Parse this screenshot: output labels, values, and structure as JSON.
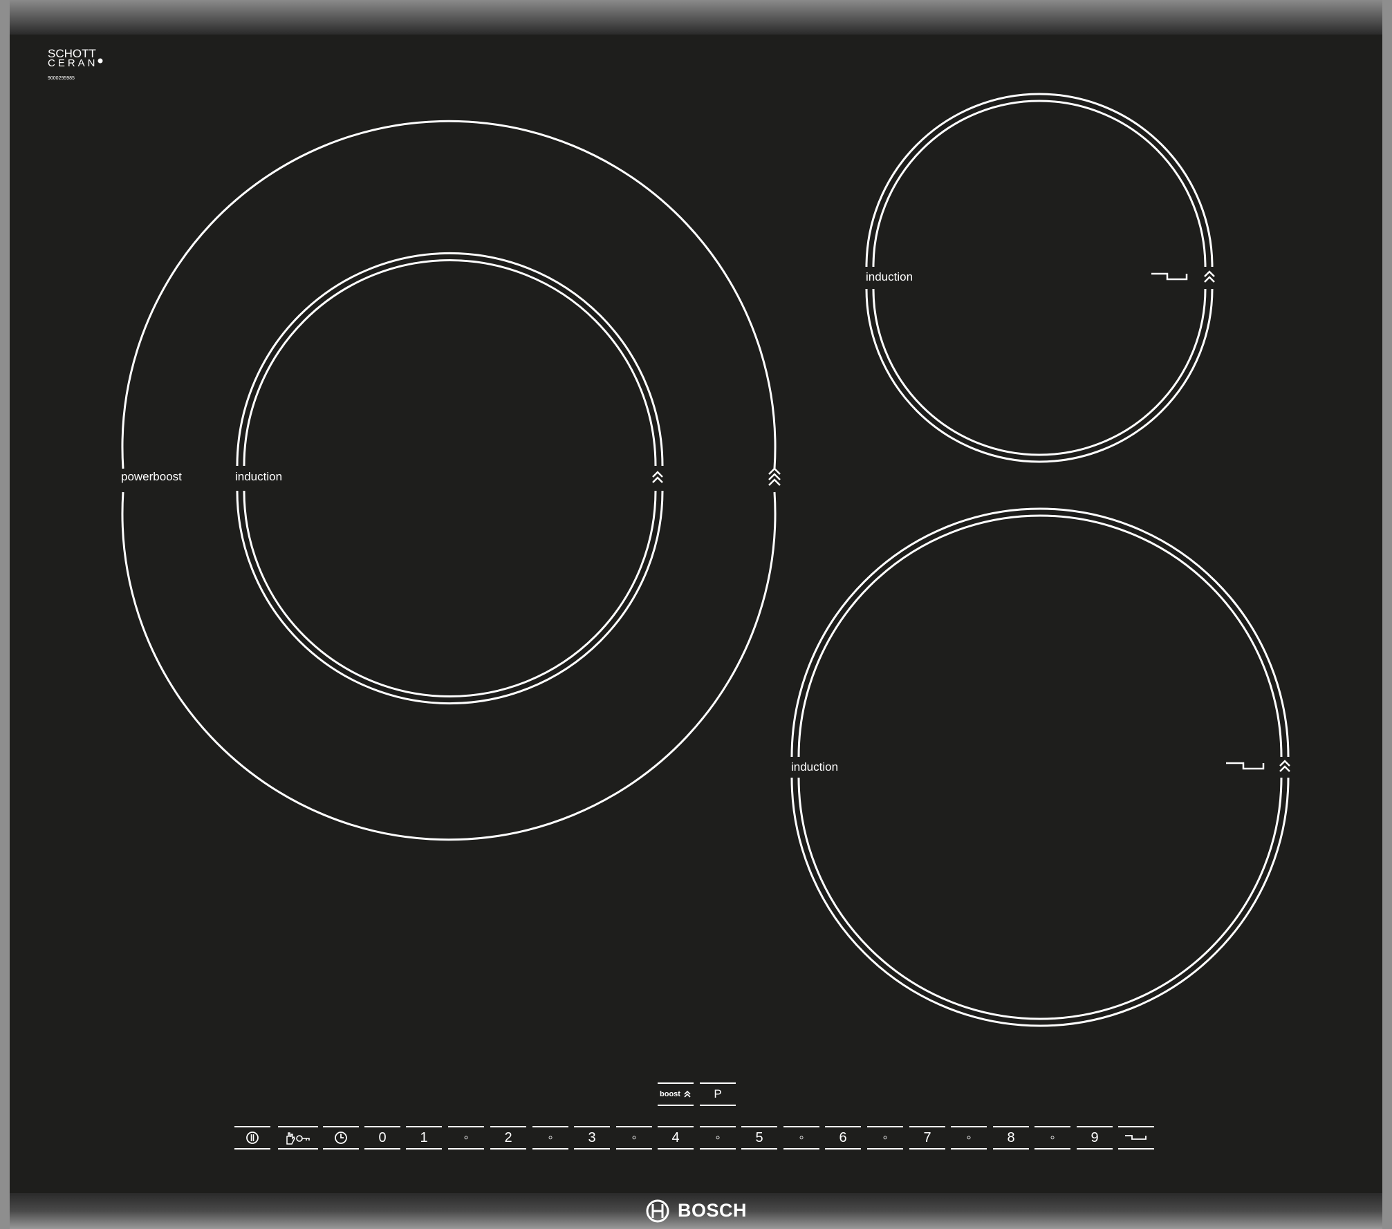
{
  "brand": {
    "logo_text": "BOSCH",
    "glass_brand_line1": "SCHOTT",
    "glass_brand_line2": "CERAN",
    "serial": "9000295985"
  },
  "zones": {
    "large": {
      "outer_label": "powerboost",
      "inner_label": "induction"
    },
    "top_right": {
      "label": "induction"
    },
    "bottom_right": {
      "label": "induction"
    }
  },
  "controls": {
    "boost_label": "boost",
    "program_symbol": "P",
    "power_levels": [
      "0",
      "1",
      "2",
      "3",
      "4",
      "5",
      "6",
      "7",
      "8",
      "9"
    ],
    "half_step_symbol": "◦"
  },
  "icons": [
    "power-icon",
    "child-lock-icon",
    "timer-icon",
    "pan-icon",
    "boost-arrows-icon",
    "bosch-logo-icon"
  ],
  "colors": {
    "glass": "#1e1e1c",
    "markings": "#ffffff",
    "frame": "#b9b9b9"
  }
}
